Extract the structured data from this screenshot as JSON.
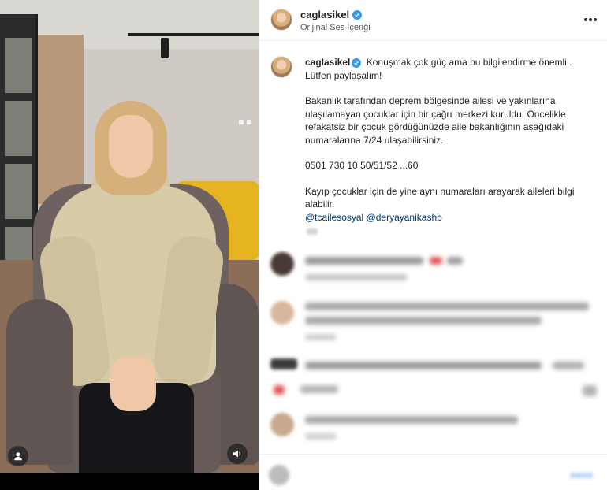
{
  "header": {
    "username": "caglasikel",
    "subtitle": "Orijinal Ses İçeriği",
    "more_icon": "more-horizontal-icon"
  },
  "caption": {
    "username": "caglasikel",
    "line1_text": "Konuşmak çok güç ama bu bilgilendirme önemli..",
    "line2": "Lütfen paylaşalım!",
    "para2": [
      "Bakanlık tarafından deprem bölgesinde ailesi ve yakınlarına",
      "ulaşılamayan çocuklar için bir çağrı merkezi kuruldu. Öncelikle",
      "refakatsiz bir çocuk gördüğünüzde aile bakanlığının aşağıdaki",
      "numaralarına 7/24 ulaşabilirsiniz."
    ],
    "phone": "0501 730 10 50/51/52 ...60",
    "para4": [
      "Kayıp çocuklar için de yine aynı numaraları arayarak aileleri bilgi",
      "alabilir."
    ],
    "mention1": "@tcailesosyal",
    "mention2": "@deryayanikashb"
  },
  "media": {
    "user_icon": "user-tag-icon",
    "volume_icon": "volume-icon"
  },
  "colors": {
    "accent": "#3897f0",
    "mention": "#00376b",
    "text": "#262626"
  }
}
